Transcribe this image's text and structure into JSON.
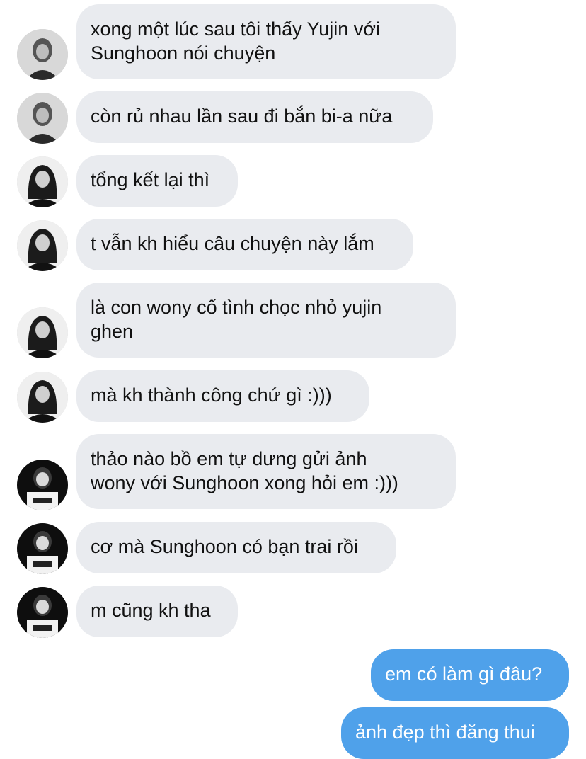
{
  "chat": {
    "incoming_bubble_color": "#e9ebef",
    "outgoing_bubble_color": "#4fa1ea",
    "messages": [
      {
        "text": "xong một lúc sau tôi thấy Yujin với\nSunghoon nói chuyện",
        "sender": "friend-1",
        "avatar_icon": "profile-photo-icon"
      },
      {
        "text": "còn rủ nhau lần sau đi bắn bi-a nữa",
        "sender": "friend-1",
        "avatar_icon": "profile-photo-icon"
      },
      {
        "text": "tổng kết lại thì",
        "sender": "friend-2",
        "avatar_icon": "profile-photo-icon"
      },
      {
        "text": "t vẫn kh hiểu câu chuyện này lắm",
        "sender": "friend-2",
        "avatar_icon": "profile-photo-icon"
      },
      {
        "text": "là con wony cố tình chọc nhỏ yujin\nghen",
        "sender": "friend-2",
        "avatar_icon": "profile-photo-icon"
      },
      {
        "text": "mà kh thành công chứ gì :)))",
        "sender": "friend-2",
        "avatar_icon": "profile-photo-icon"
      },
      {
        "text": "thảo nào bồ em tự dưng gửi ảnh\nwony với Sunghoon xong hỏi em :)))",
        "sender": "friend-3",
        "avatar_icon": "profile-photo-icon"
      },
      {
        "text": "cơ mà Sunghoon có bạn trai rồi",
        "sender": "friend-3",
        "avatar_icon": "profile-photo-icon"
      },
      {
        "text": "m cũng kh tha",
        "sender": "friend-3",
        "avatar_icon": "profile-photo-icon"
      },
      {
        "text": "em có làm gì đâu?",
        "sender": "me"
      },
      {
        "text": "ảnh đẹp thì đăng thui",
        "sender": "me"
      }
    ]
  }
}
